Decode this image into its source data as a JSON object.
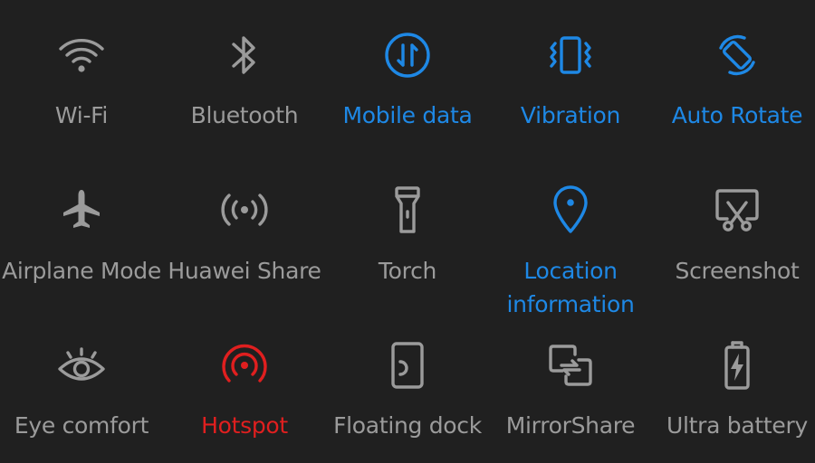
{
  "quick_settings": {
    "tiles": [
      {
        "label": "Wi-Fi",
        "state": "off",
        "icon": "wifi-icon"
      },
      {
        "label": "Bluetooth",
        "state": "off",
        "icon": "bluetooth-icon"
      },
      {
        "label": "Mobile data",
        "state": "on",
        "icon": "mobile-data-icon"
      },
      {
        "label": "Vibration",
        "state": "on",
        "icon": "vibration-icon"
      },
      {
        "label": "Auto Rotate",
        "state": "on",
        "icon": "auto-rotate-icon"
      },
      {
        "label": "Airplane Mode",
        "state": "off",
        "icon": "airplane-icon"
      },
      {
        "label": "Huawei Share",
        "state": "off",
        "icon": "huawei-share-icon"
      },
      {
        "label": "Torch",
        "state": "off",
        "icon": "torch-icon"
      },
      {
        "label": "Location information",
        "label_lines": [
          "Location",
          "information"
        ],
        "state": "on",
        "icon": "location-pin-icon"
      },
      {
        "label": "Screenshot",
        "state": "off",
        "icon": "screenshot-icon"
      },
      {
        "label": "Eye comfort",
        "state": "off",
        "icon": "eye-icon"
      },
      {
        "label": "Hotspot",
        "state": "active",
        "icon": "hotspot-icon"
      },
      {
        "label": "Floating dock",
        "state": "off",
        "icon": "floating-dock-icon"
      },
      {
        "label": "MirrorShare",
        "state": "off",
        "icon": "mirror-share-icon"
      },
      {
        "label": "Ultra battery",
        "state": "off",
        "icon": "ultra-battery-icon"
      }
    ]
  },
  "colors": {
    "background": "#202020",
    "inactive": "#9b9b9b",
    "active": "#1e88e5",
    "hotspot": "#e01f1f"
  }
}
